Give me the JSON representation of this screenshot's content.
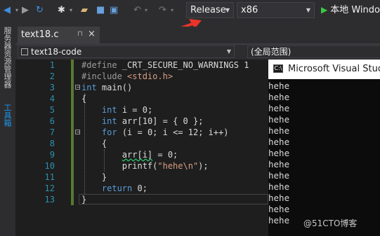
{
  "toolbar": {
    "config_value": "Release",
    "platform_value": "x86",
    "run_label": "本地 Windo",
    "icons": [
      "back-icon",
      "forward-icon",
      "new-project-icon",
      "open-folder-icon",
      "save-icon",
      "save-all-icon",
      "undo-icon",
      "redo-icon"
    ]
  },
  "strip": {
    "items": [
      "服务器资源管理器",
      "工具箱"
    ]
  },
  "tab": {
    "name": "text18.c",
    "pin": "⊓",
    "close": "×"
  },
  "nav": {
    "scope": "text18-code",
    "member": "(全局范围)"
  },
  "editor": {
    "line_numbers": [
      "1",
      "2",
      "3",
      "4",
      "5",
      "6",
      "7",
      "8",
      "9",
      "10",
      "11",
      "12",
      "13"
    ]
  },
  "console": {
    "title": "Microsoft Visual Studio",
    "lines": [
      "hehe",
      "hehe",
      "hehe",
      "hehe",
      "hehe",
      "hehe",
      "hehe",
      "hehe",
      "hehe",
      "hehe",
      "hehe",
      "hehe",
      "hehe"
    ]
  },
  "watermark": "@51CTO博客",
  "colors": {
    "keyword": "#569cd6",
    "string": "#d69d85",
    "accent": "#3ec844",
    "annotation_arrow": "#e8342a"
  }
}
